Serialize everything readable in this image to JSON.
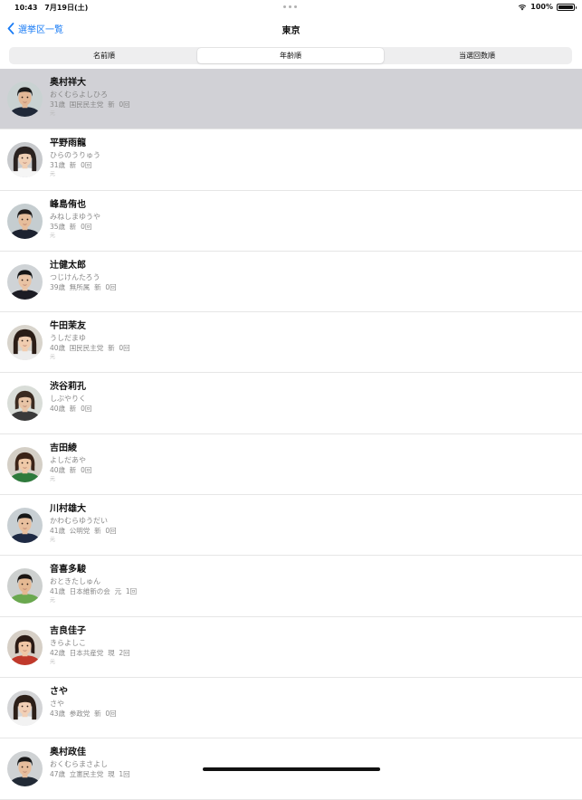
{
  "status_bar": {
    "time": "10:43",
    "date": "7月19日(土)",
    "battery": "100%",
    "battery_level": 1.0
  },
  "nav": {
    "back_label": "選挙区一覧",
    "title": "東京"
  },
  "segments": [
    {
      "label": "名前順",
      "selected": false
    },
    {
      "label": "年齢順",
      "selected": true
    },
    {
      "label": "当選回数順",
      "selected": false
    }
  ],
  "candidates": [
    {
      "name": "奥村祥大",
      "kana": "おくむらよしひろ",
      "meta": "31歳  国民民主党  新  0回",
      "tag": "元",
      "selected": true,
      "face": {
        "bg": "#c9d2d2",
        "skin": "#e3b896",
        "hair": "#1b1b1b",
        "shirt": "#202838",
        "hair_style": "short"
      }
    },
    {
      "name": "平野雨龍",
      "kana": "ひらのうりゅう",
      "meta": "31歳  新  0回",
      "tag": "元",
      "selected": false,
      "face": {
        "bg": "#c7c9cc",
        "skin": "#f0cfb4",
        "hair": "#2a2220",
        "shirt": "#f5f5f5",
        "hair_style": "long"
      }
    },
    {
      "name": "峰島侑也",
      "kana": "みねしまゆうや",
      "meta": "35歳  新  0回",
      "tag": "元",
      "selected": false,
      "face": {
        "bg": "#c5cdd0",
        "skin": "#e6bd9b",
        "hair": "#1f1a18",
        "shirt": "#1c2230",
        "hair_style": "short"
      }
    },
    {
      "name": "辻健太郎",
      "kana": "つじけんたろう",
      "meta": "39歳  無所属  新  0回",
      "tag": "",
      "selected": false,
      "face": {
        "bg": "#cfd3d6",
        "skin": "#e9c3a4",
        "hair": "#141414",
        "shirt": "#1c1c24",
        "hair_style": "short"
      }
    },
    {
      "name": "牛田茉友",
      "kana": "うしだまゆ",
      "meta": "40歳  国民民主党  新  0回",
      "tag": "元",
      "selected": false,
      "face": {
        "bg": "#d8d4cc",
        "skin": "#f1cdb0",
        "hair": "#2b1d16",
        "shirt": "#ececec",
        "hair_style": "long"
      }
    },
    {
      "name": "渋谷莉孔",
      "kana": "しぶやりく",
      "meta": "40歳  新  0回",
      "tag": "",
      "selected": false,
      "face": {
        "bg": "#d9ddd8",
        "skin": "#e8c4a6",
        "hair": "#3a2a20",
        "shirt": "#3a3a3a",
        "hair_style": "bob"
      }
    },
    {
      "name": "吉田綾",
      "kana": "よしだあや",
      "meta": "40歳  新  0回",
      "tag": "元",
      "selected": false,
      "face": {
        "bg": "#d4cfc6",
        "skin": "#efc9a8",
        "hair": "#3b2418",
        "shirt": "#2e7a3c",
        "hair_style": "bob"
      }
    },
    {
      "name": "川村雄大",
      "kana": "かわむらゆうだい",
      "meta": "41歳  公明党  新  0回",
      "tag": "元",
      "selected": false,
      "face": {
        "bg": "#c8cfd3",
        "skin": "#e8bf9e",
        "hair": "#161616",
        "shirt": "#1e2a44",
        "hair_style": "short"
      }
    },
    {
      "name": "音喜多駿",
      "kana": "おときたしゅん",
      "meta": "41歳  日本維新の会  元  1回",
      "tag": "元",
      "selected": false,
      "face": {
        "bg": "#cdd0cf",
        "skin": "#e4b892",
        "hair": "#1a1512",
        "shirt": "#6aa84f",
        "hair_style": "short"
      }
    },
    {
      "name": "吉良佳子",
      "kana": "きらよしこ",
      "meta": "42歳  日本共産党  現  2回",
      "tag": "元",
      "selected": false,
      "face": {
        "bg": "#d6cfc6",
        "skin": "#f0c6a5",
        "hair": "#2a1a14",
        "shirt": "#c0392b",
        "hair_style": "bob"
      }
    },
    {
      "name": "さや",
      "kana": "さや",
      "meta": "43歳  参政党  新  0回",
      "tag": "",
      "selected": false,
      "face": {
        "bg": "#d3d4d6",
        "skin": "#f2d0b6",
        "hair": "#2c1f18",
        "shirt": "#f2f2f2",
        "hair_style": "long"
      }
    },
    {
      "name": "奥村政佳",
      "kana": "おくむらまさよし",
      "meta": "47歳  立憲民主党  現  1回",
      "tag": "",
      "selected": false,
      "face": {
        "bg": "#cfd2d4",
        "skin": "#e7bd9c",
        "hair": "#1a1a1a",
        "shirt": "#222a36",
        "hair_style": "short"
      }
    }
  ]
}
